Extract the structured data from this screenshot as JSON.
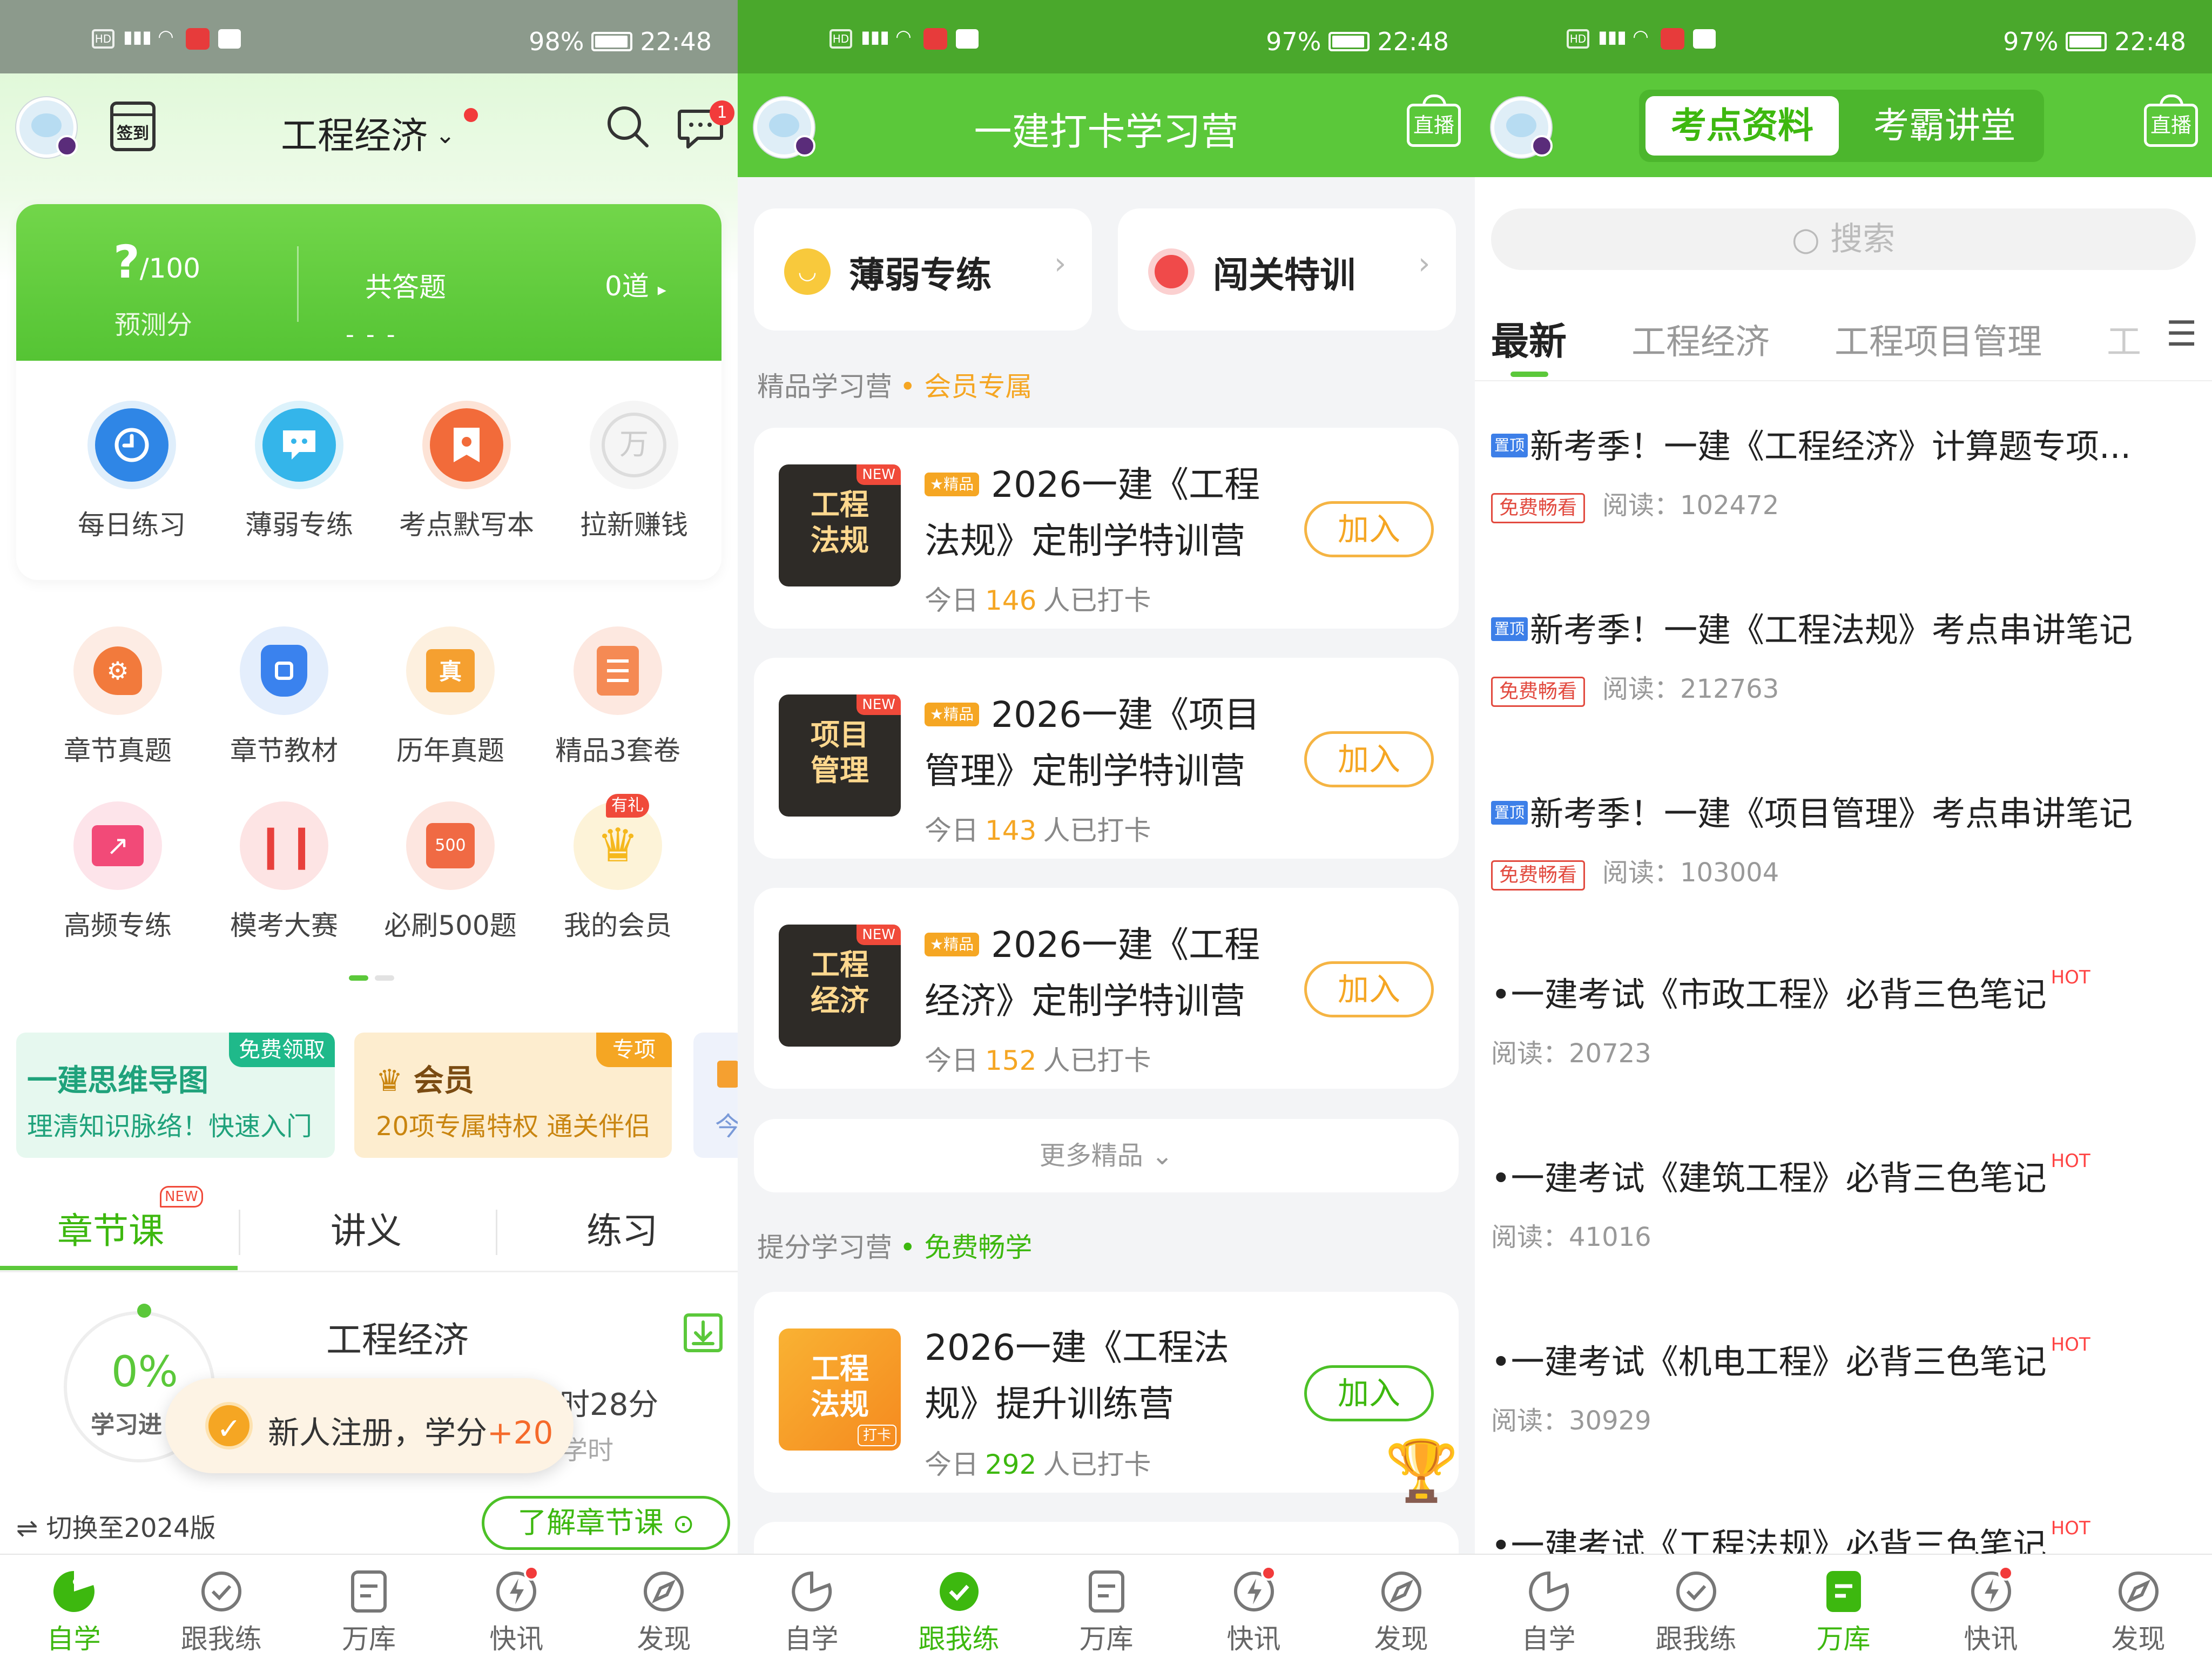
{
  "colors": {
    "brand_green": "#5bc83a",
    "accent_orange": "#f5a623",
    "badge_red": "#f23b3b",
    "pin_blue": "#3d7fe8"
  },
  "screen1": {
    "status": {
      "battery": "98%",
      "time": "22:48"
    },
    "header": {
      "checkin": "签到",
      "subject": "工程经济",
      "msg_badge": "1"
    },
    "score_card": {
      "score": "?",
      "score_total": "/100",
      "score_label": "预测分",
      "answered_label": "共答题",
      "answered_value": "0道",
      "dash": "- - -"
    },
    "quick": [
      {
        "label": "每日练习",
        "icon": "clock-icon"
      },
      {
        "label": "薄弱专练",
        "icon": "chat-icon"
      },
      {
        "label": "考点默写本",
        "icon": "bookmark-icon"
      },
      {
        "label": "拉新赚钱",
        "icon": "coin-icon",
        "char": "万"
      }
    ],
    "grid": [
      {
        "label": "章节真题",
        "icon": "gear-icon"
      },
      {
        "label": "章节教材",
        "icon": "shield-icon"
      },
      {
        "label": "历年真题",
        "icon": "folder-icon",
        "char": "真"
      },
      {
        "label": "精品3套卷",
        "icon": "list-icon"
      },
      {
        "label": "高频专练",
        "icon": "trend-icon"
      },
      {
        "label": "模考大赛",
        "icon": "sword-icon"
      },
      {
        "label": "必刷500题",
        "icon": "calendar-icon",
        "char": "500"
      },
      {
        "label": "我的会员",
        "icon": "crown-icon",
        "tag": "有礼"
      }
    ],
    "banners": [
      {
        "title": "一建思维导图",
        "tag": "免费领取",
        "desc": "理清知识脉络！快速入门"
      },
      {
        "title": "会员",
        "tag": "专项",
        "desc": "20项专属特权  通关伴侣"
      },
      {
        "desc": "今"
      }
    ],
    "tabs": [
      {
        "label": "章节课",
        "tag": "NEW"
      },
      {
        "label": "讲义"
      },
      {
        "label": "练习"
      }
    ],
    "course": {
      "progress": "0%",
      "progress_label": "学习进",
      "subject": "工程经济",
      "time_fragment": "时28分",
      "sub_fragment": "学时"
    },
    "toast": {
      "text": "新人注册，学分",
      "bonus": "+20"
    },
    "switch_label": "⇌ 切换至2024版",
    "learn_btn": "了解章节课"
  },
  "screen2": {
    "status": {
      "battery": "97%",
      "time": "22:48"
    },
    "title": "一建打卡学习营",
    "live": "直播",
    "top_cards": [
      {
        "label": "薄弱专练"
      },
      {
        "label": "闯关特训"
      }
    ],
    "premium_section": {
      "label": "精品学习营",
      "tag": "会员专属"
    },
    "camps": [
      {
        "thumb1": "工程",
        "thumb2": "法规",
        "new": "NEW",
        "badge": "★精品",
        "title": "2026一建《工程法规》定制学特训营",
        "sub_pre": "今日",
        "count": "146",
        "sub_post": "人已打卡",
        "join": "加入"
      },
      {
        "thumb1": "项目",
        "thumb2": "管理",
        "new": "NEW",
        "badge": "★精品",
        "title": "2026一建《项目管理》定制学特训营",
        "sub_pre": "今日",
        "count": "143",
        "sub_post": "人已打卡",
        "join": "加入"
      },
      {
        "thumb1": "工程",
        "thumb2": "经济",
        "new": "NEW",
        "badge": "★精品",
        "title": "2026一建《工程经济》定制学特训营",
        "sub_pre": "今日",
        "count": "152",
        "sub_post": "人已打卡",
        "join": "加入"
      }
    ],
    "more": "更多精品",
    "free_section": {
      "label": "提分学习营",
      "tag": "免费畅学"
    },
    "free_camp": {
      "thumb1": "工程",
      "thumb2": "法规",
      "thumb_tag": "打卡",
      "title": "2026一建《工程法规》提升训练营",
      "sub_pre": "今日",
      "count": "292",
      "sub_post": "人已打卡",
      "join": "加入"
    }
  },
  "screen3": {
    "status": {
      "battery": "97%",
      "time": "22:48"
    },
    "seg": [
      "考点资料",
      "考霸讲堂"
    ],
    "live": "直播",
    "search_placeholder": "搜索",
    "tabs": [
      "最新",
      "工程经济",
      "工程项目管理",
      "工"
    ],
    "news": [
      {
        "pin": "置顶",
        "title": "新考季！一建《工程经济》计算题专项...",
        "free": "免费畅看",
        "reads": "阅读：102472"
      },
      {
        "pin": "置顶",
        "title": "新考季！一建《工程法规》考点串讲笔记",
        "free": "免费畅看",
        "reads": "阅读：212763"
      },
      {
        "pin": "置顶",
        "title": "新考季！一建《项目管理》考点串讲笔记",
        "free": "免费畅看",
        "reads": "阅读：103004"
      },
      {
        "title": "•一建考试《市政工程》必背三色笔记",
        "hot": "HOT",
        "reads": "阅读：20723"
      },
      {
        "title": "•一建考试《建筑工程》必背三色笔记",
        "hot": "HOT",
        "reads": "阅读：41016"
      },
      {
        "title": "•一建考试《机电工程》必背三色笔记",
        "hot": "HOT",
        "reads": "阅读：30929"
      },
      {
        "title": "•一建考试《工程法规》必背三色笔记",
        "hot": "HOT"
      }
    ]
  },
  "nav": [
    "自学",
    "跟我练",
    "万库",
    "快讯",
    "发现"
  ]
}
